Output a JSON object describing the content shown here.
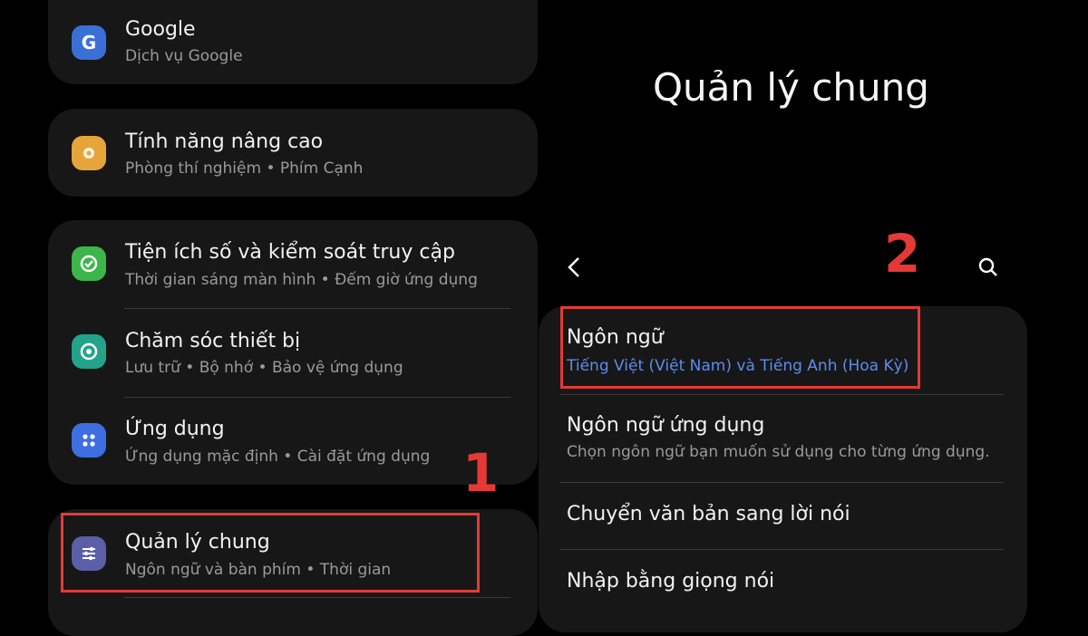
{
  "left_panel": {
    "google": {
      "title": "Google",
      "subtitle": "Dịch vụ Google",
      "icon": "google-icon",
      "color": "#3b6fd8"
    },
    "advanced": {
      "title": "Tính năng nâng cao",
      "subtitle": "Phòng thí nghiệm • Phím Cạnh",
      "icon": "puzzle-icon",
      "color": "#e6a53a"
    },
    "wellbeing": {
      "title": "Tiện ích số và kiểm soát truy cập",
      "subtitle": "Thời gian sáng màn hình • Đếm giờ ứng dụng",
      "icon": "wellbeing-icon",
      "color": "#3cb54a"
    },
    "device_care": {
      "title": "Chăm sóc thiết bị",
      "subtitle": "Lưu trữ • Bộ nhớ • Bảo vệ ứng dụng",
      "icon": "device-care-icon",
      "color": "#23a38a"
    },
    "apps": {
      "title": "Ứng dụng",
      "subtitle": "Ứng dụng mặc định • Cài đặt ứng dụng",
      "icon": "apps-icon",
      "color": "#3d6fe0"
    },
    "general": {
      "title": "Quản lý chung",
      "subtitle": "Ngôn ngữ và bàn phím • Thời gian",
      "icon": "sliders-icon",
      "color": "#5b5fa8"
    }
  },
  "right_panel": {
    "page_title": "Quản lý chung",
    "items": [
      {
        "title": "Ngôn ngữ",
        "subtitle": "Tiếng Việt (Việt Nam) và Tiếng Anh (Hoa Kỳ)"
      },
      {
        "title": "Ngôn ngữ ứng dụng",
        "subtitle": "Chọn ngôn ngữ bạn muốn sử dụng cho từng ứng dụng."
      },
      {
        "title": "Chuyển văn bản sang lời nói"
      },
      {
        "title": "Nhập bằng giọng nói"
      }
    ]
  },
  "annotations": {
    "step1": "1",
    "step2": "2",
    "color": "#e53935"
  },
  "accent": {
    "link_blue": "#5b8def"
  }
}
